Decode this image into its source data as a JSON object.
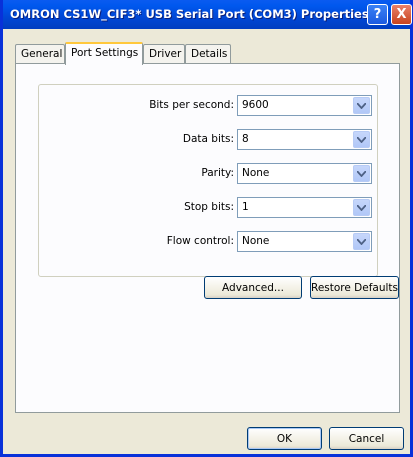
{
  "window": {
    "title": "OMRON CS1W_CIF3* USB Serial Port (COM3) Properties",
    "help_glyph": "?",
    "close_glyph": "X"
  },
  "tabs": [
    {
      "label": "General"
    },
    {
      "label": "Port Settings"
    },
    {
      "label": "Driver"
    },
    {
      "label": "Details"
    }
  ],
  "port_settings": {
    "fields": [
      {
        "label": "Bits per second:",
        "value": "9600"
      },
      {
        "label": "Data bits:",
        "value": "8"
      },
      {
        "label": "Parity:",
        "value": "None"
      },
      {
        "label": "Stop bits:",
        "value": "1"
      },
      {
        "label": "Flow control:",
        "value": "None"
      }
    ],
    "advanced_label": "Advanced...",
    "restore_label": "Restore Defaults"
  },
  "footer": {
    "ok_label": "OK",
    "cancel_label": "Cancel"
  },
  "colors": {
    "title_bar": "#0054e3",
    "face": "#ece9d8",
    "active_tab_accent": "#ffc83c"
  },
  "icons": {
    "help": "help-icon",
    "close": "close-icon",
    "dropdown": "chevron-down-icon"
  }
}
